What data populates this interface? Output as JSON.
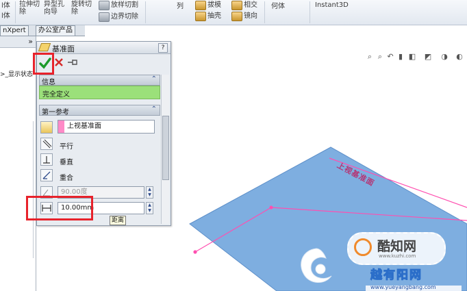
{
  "ribbon": {
    "items": [
      {
        "text": "l体"
      },
      {
        "text": "l体"
      },
      {
        "text": "拉伸切\n除"
      },
      {
        "text": "异型孔\n向导"
      },
      {
        "text": "旋转切\n除"
      },
      {
        "text": "放样切割"
      },
      {
        "text": "边界切除"
      },
      {
        "text": "列"
      },
      {
        "text": "拔模"
      },
      {
        "text": "抽壳"
      },
      {
        "text": "相交"
      },
      {
        "text": "镜向"
      },
      {
        "text": "何体"
      },
      {
        "text": "Instant3D"
      }
    ]
  },
  "tabs": [
    "nXpert",
    "办公室产品"
  ],
  "tree": {
    "expand": "»",
    "row": ">_显示状态"
  },
  "property_manager": {
    "title": "基准面",
    "help": "?",
    "info_group": {
      "title": "信息",
      "status": "完全定义",
      "collapse": "⌃"
    },
    "first_ref_group": {
      "title": "第一参考",
      "collapse": "⌃",
      "selection": "上视基准面",
      "options": [
        "平行",
        "垂直",
        "重合"
      ],
      "angle_value": "90.00度",
      "distance_value": "10.00mm",
      "tooltip": "距离"
    }
  },
  "viewport": {
    "plane_label": "上视基准面"
  },
  "watermarks": {
    "logo_text": "酷知网",
    "logo_sub": "www.kuzhi.com",
    "site_text": "越有阳网",
    "site_url": "www.yueyangbang.com"
  },
  "colors": {
    "accent_green": "#9be07a",
    "plane_blue": "#7eaee0",
    "highlight_red": "#e8222b",
    "pink_swatch": "#ff8ac7"
  }
}
